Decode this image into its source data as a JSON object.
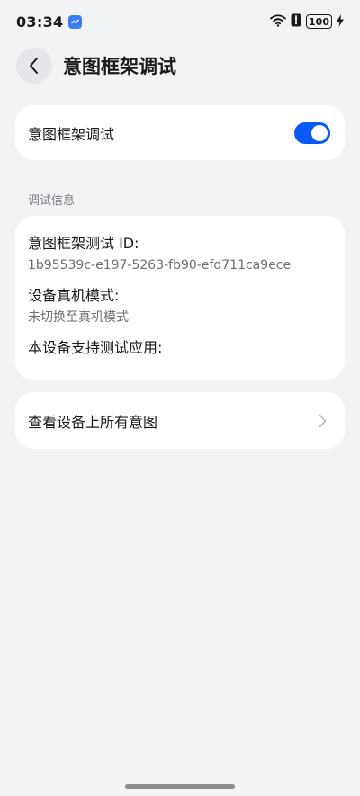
{
  "status_bar": {
    "time": "03:34",
    "battery_level": "100",
    "icons": [
      "app-notification-icon",
      "wifi-icon",
      "battery-saver-icon",
      "battery-icon",
      "charging-icon"
    ]
  },
  "header": {
    "title": "意图框架调试"
  },
  "toggle_row": {
    "label": "意图框架调试",
    "enabled": true
  },
  "debug_info": {
    "section_title": "调试信息",
    "test_id_label": "意图框架测试 ID:",
    "test_id_value": "1b95539c-e197-5263-fb90-efd711ca9ece",
    "device_mode_label": "设备真机模式:",
    "device_mode_value": "未切换至真机模式",
    "supported_apps_label": "本设备支持测试应用:"
  },
  "link_row": {
    "label": "查看设备上所有意图"
  },
  "colors": {
    "accent": "#0a59f7",
    "background": "#f1f3f5",
    "card": "#ffffff"
  }
}
